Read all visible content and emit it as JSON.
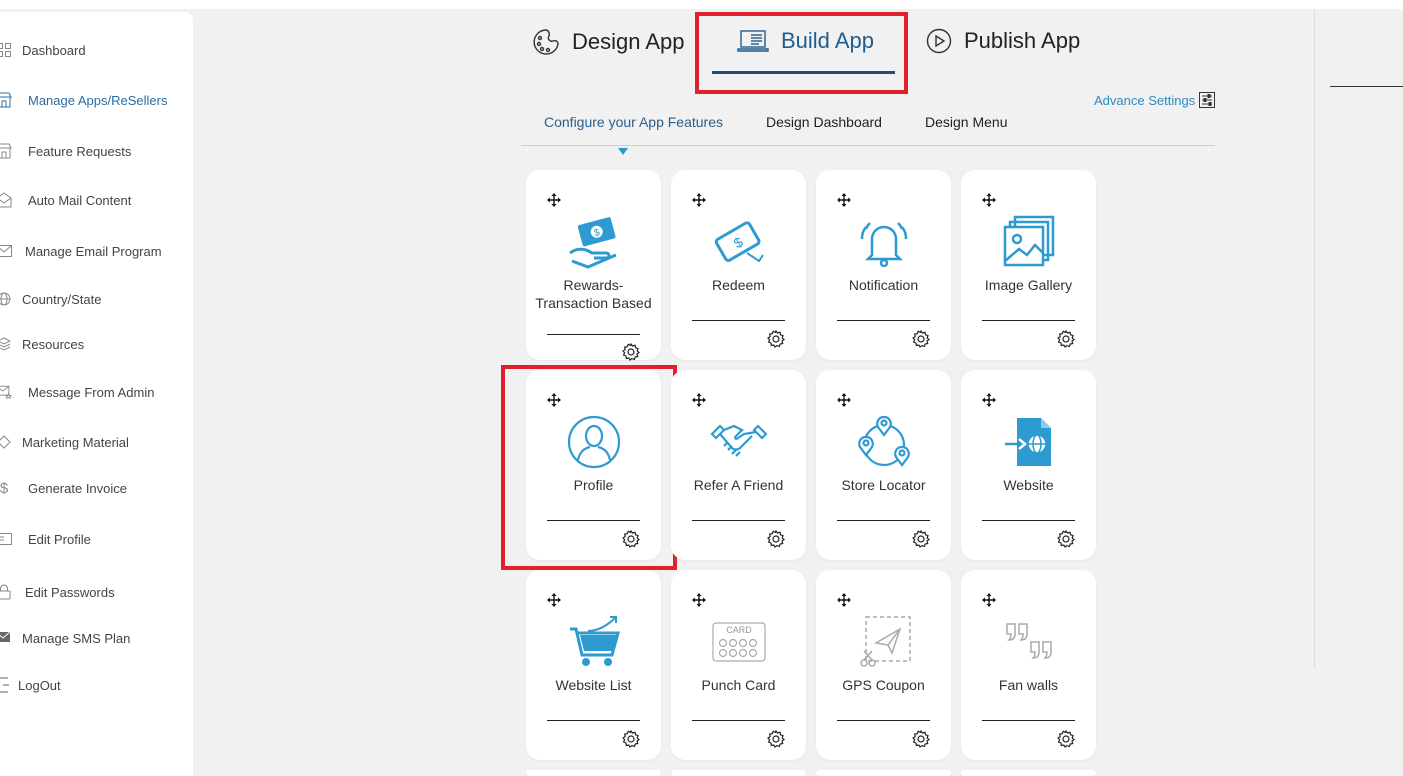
{
  "sidebar": {
    "items": [
      {
        "label": "Dashboard",
        "icon": "grid-icon"
      },
      {
        "label": "Manage Apps/ReSellers",
        "icon": "store-icon"
      },
      {
        "label": "Feature Requests",
        "icon": "store-icon"
      },
      {
        "label": "Auto Mail Content",
        "icon": "mail-open-icon"
      },
      {
        "label": "Manage Email Program",
        "icon": "envelope-icon"
      },
      {
        "label": "Country/State",
        "icon": "globe-icon"
      },
      {
        "label": "Resources",
        "icon": "layers-icon"
      },
      {
        "label": "Message From Admin",
        "icon": "mail-star-icon"
      },
      {
        "label": "Marketing Material",
        "icon": "diamond-icon"
      },
      {
        "label": "Generate Invoice",
        "icon": "dollar-icon"
      },
      {
        "label": "Edit Profile",
        "icon": "id-card-icon"
      },
      {
        "label": "Edit Passwords",
        "icon": "lock-icon"
      },
      {
        "label": "Manage SMS Plan",
        "icon": "sms-icon"
      },
      {
        "label": "LogOut",
        "icon": "logout-icon"
      }
    ]
  },
  "tabs": {
    "design": "Design App",
    "build": "Build App",
    "publish": "Publish App"
  },
  "subtabs": {
    "configure": "Configure your App Features",
    "dashboard": "Design Dashboard",
    "menu": "Design Menu"
  },
  "advance_settings": "Advance Settings",
  "features": [
    {
      "label": "Rewards- Transaction Based",
      "icon": "rewards-transaction-icon"
    },
    {
      "label": "Redeem",
      "icon": "redeem-icon"
    },
    {
      "label": "Notification",
      "icon": "notification-bell-icon"
    },
    {
      "label": "Image Gallery",
      "icon": "image-gallery-icon"
    },
    {
      "label": "Profile",
      "icon": "profile-icon"
    },
    {
      "label": "Refer A Friend",
      "icon": "handshake-icon"
    },
    {
      "label": "Store Locator",
      "icon": "store-locator-icon"
    },
    {
      "label": "Website",
      "icon": "website-icon"
    },
    {
      "label": "Website List",
      "icon": "shopping-cart-icon"
    },
    {
      "label": "Punch Card",
      "icon": "punch-card-icon"
    },
    {
      "label": "GPS Coupon",
      "icon": "gps-coupon-icon"
    },
    {
      "label": "Fan walls",
      "icon": "quotes-icon"
    }
  ],
  "colors": {
    "accent": "#2d9ad1",
    "highlight": "#e0202a",
    "active_tab": "#1f5d8f"
  },
  "punch_card_text": "CARD"
}
